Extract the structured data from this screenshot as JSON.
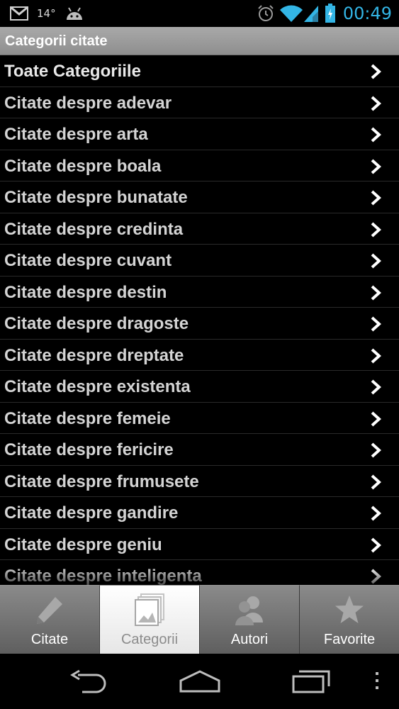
{
  "status_bar": {
    "temperature": "14°",
    "time": "00:49",
    "icons": [
      "gmail-icon",
      "android-icon",
      "alarm-icon",
      "wifi-icon",
      "signal-icon",
      "battery-icon"
    ]
  },
  "action_bar": {
    "title": "Categorii citate"
  },
  "categories": [
    "Toate Categoriile",
    "Citate despre adevar",
    "Citate despre arta",
    "Citate despre boala",
    "Citate despre bunatate",
    "Citate despre credinta",
    "Citate despre cuvant",
    "Citate despre destin",
    "Citate despre dragoste",
    "Citate despre dreptate",
    "Citate despre existenta",
    "Citate despre femeie",
    "Citate despre fericire",
    "Citate despre frumusete",
    "Citate despre gandire",
    "Citate despre geniu",
    "Citate despre inteligenta"
  ],
  "tabs": [
    {
      "label": "Citate",
      "icon": "pencil-icon",
      "active": false
    },
    {
      "label": "Categorii",
      "icon": "pictures-icon",
      "active": true
    },
    {
      "label": "Autori",
      "icon": "people-icon",
      "active": false
    },
    {
      "label": "Favorite",
      "icon": "star-icon",
      "active": false
    }
  ],
  "colors": {
    "accent": "#33b5e5",
    "action_bar": "#9a9a9a",
    "list_text": "#d4d4d4"
  }
}
